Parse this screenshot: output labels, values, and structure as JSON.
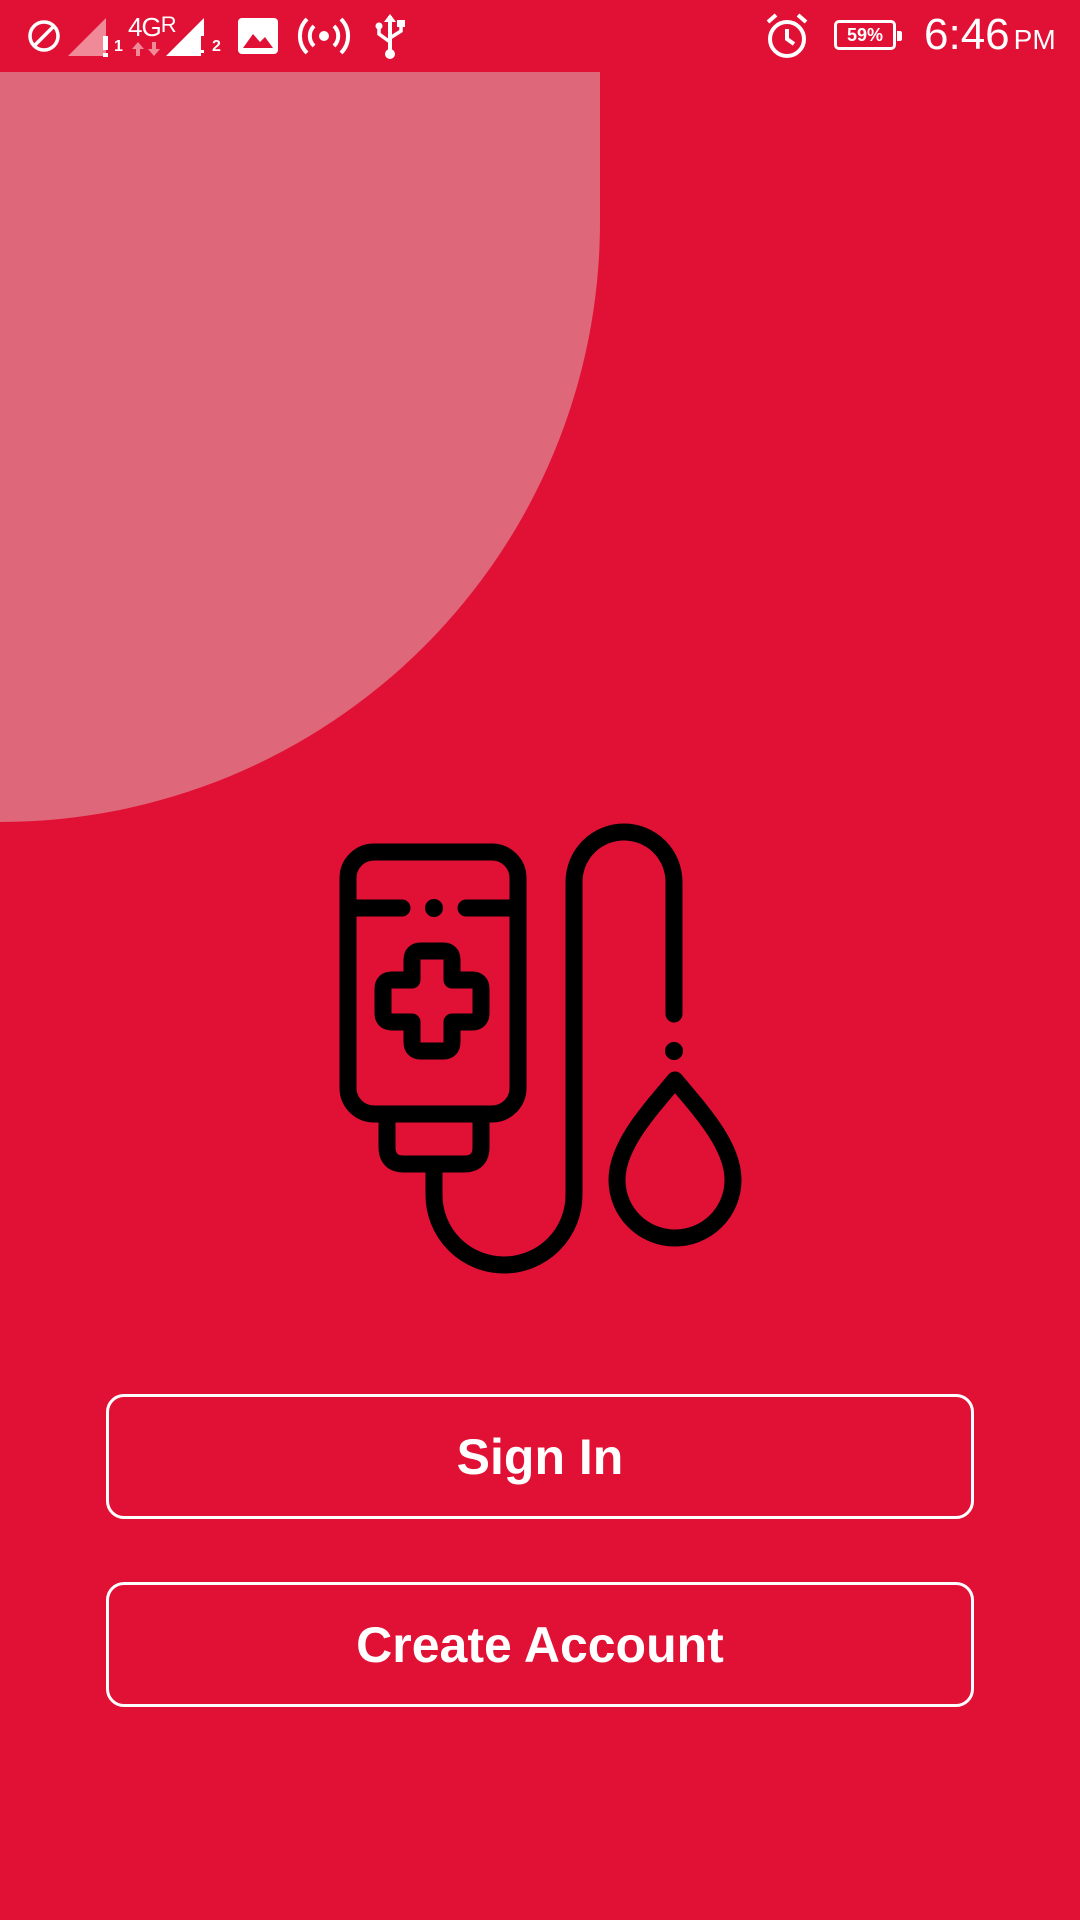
{
  "status_bar": {
    "network_type": "4G",
    "roaming": "R",
    "sim1_index": "1",
    "sim2_index": "2",
    "battery_percent": "59%",
    "time": "6:46",
    "ampm": "PM",
    "icons": [
      "do-not-disturb-icon",
      "signal-sim1-icon",
      "signal-sim2-icon",
      "image-icon",
      "hotspot-icon",
      "usb-icon",
      "alarm-icon",
      "battery-icon"
    ]
  },
  "logo": {
    "icon": "blood-transfusion-bag-icon",
    "stroke_color": "#000000"
  },
  "actions": {
    "sign_in_label": "Sign In",
    "create_account_label": "Create Account"
  },
  "colors": {
    "background": "#E11136",
    "accent_shape": "#DF677A",
    "button_border": "#FFFFFF",
    "button_text": "#FFFFFF"
  }
}
